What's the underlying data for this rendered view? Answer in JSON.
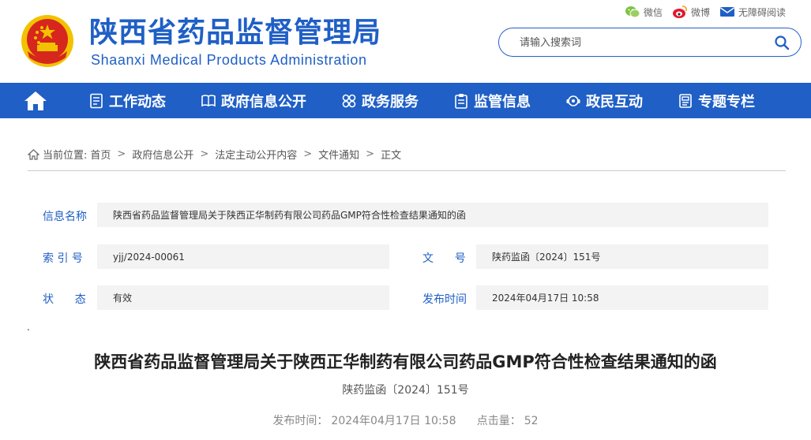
{
  "header": {
    "title_cn": "陕西省药品监督管理局",
    "title_en": "Shaanxi Medical Products Administration",
    "links": [
      {
        "label": "微信",
        "icon": "wechat-icon"
      },
      {
        "label": "微博",
        "icon": "weibo-icon"
      },
      {
        "label": "无障碍阅读",
        "icon": "mail-icon"
      }
    ],
    "search": {
      "placeholder": "请输入搜索词",
      "value": ""
    }
  },
  "nav": {
    "items": [
      {
        "label": "工作动态",
        "icon": "document-list-icon"
      },
      {
        "label": "政府信息公开",
        "icon": "book-icon"
      },
      {
        "label": "政务服务",
        "icon": "grid-icon"
      },
      {
        "label": "监管信息",
        "icon": "clipboard-icon"
      },
      {
        "label": "政民互动",
        "icon": "chat-icon"
      },
      {
        "label": "专题专栏",
        "icon": "folder-icon"
      }
    ]
  },
  "breadcrumb": {
    "prefix": "当前位置:",
    "items": [
      "首页",
      "政府信息公开",
      "法定主动公开内容",
      "文件通知",
      "正文"
    ]
  },
  "info": {
    "name_label": "信息名称",
    "name_value": "陕西省药品监督管理局关于陕西正华制药有限公司药品GMP符合性检查结果通知的函",
    "index_label": "索 引 号",
    "index_value": "yjj/2024-00061",
    "docno_label": "文      号",
    "docno_value": "陕药监函〔2024〕151号",
    "status_label": "状      态",
    "status_value": "有效",
    "date_label": "发布时间",
    "date_value": "2024年04月17日 10:58"
  },
  "article": {
    "dot": ".",
    "title": "陕西省药品监督管理局关于陕西正华制药有限公司药品GMP符合性检查结果通知的函",
    "doc_no": "陕药监函〔2024〕151号",
    "publish_label": "发布时间：",
    "publish_time": "2024年04月17日 10:58",
    "hits_label": "点击量：",
    "hits": "52"
  },
  "colors": {
    "brand": "#1f5fc6",
    "emblem_red": "#d7261e",
    "emblem_gold": "#f2c200"
  }
}
